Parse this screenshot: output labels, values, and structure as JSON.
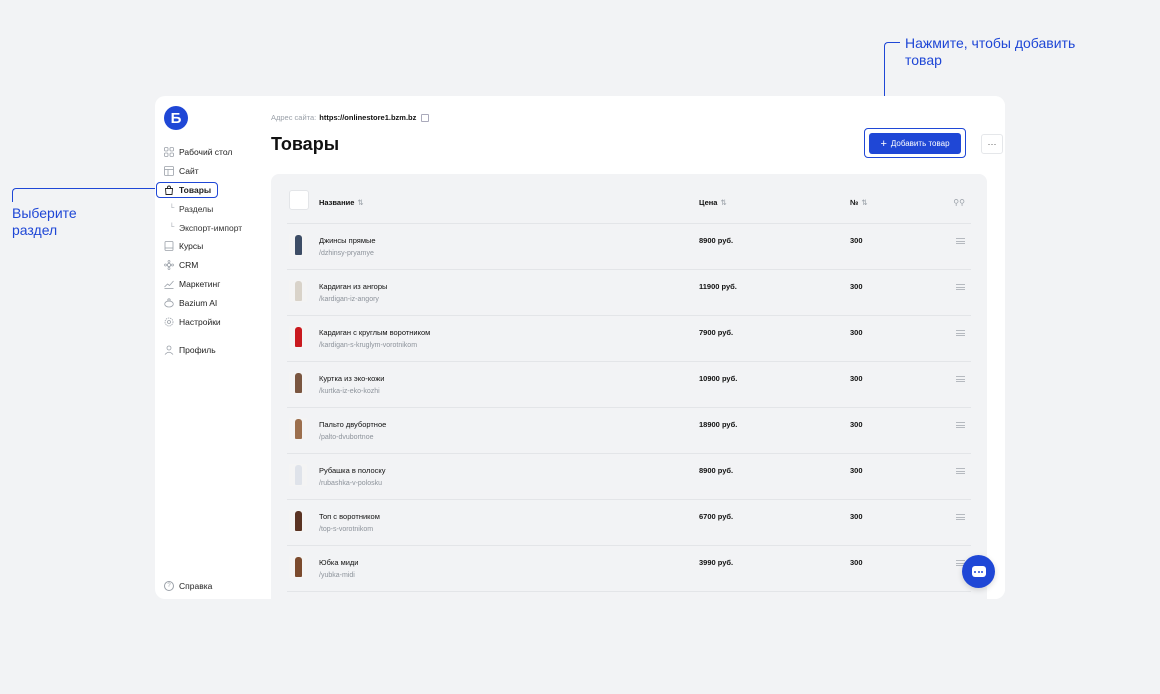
{
  "annotations": {
    "select_section": "Выберите раздел",
    "add_product_hint": "Нажмите, чтобы добавить товар"
  },
  "sidebar": {
    "logo": "Б",
    "items": [
      {
        "label": "Рабочий стол",
        "icon": "grid-icon"
      },
      {
        "label": "Сайт",
        "icon": "layout-icon"
      },
      {
        "label": "Товары",
        "icon": "bag-icon",
        "active": true
      },
      {
        "label": "Разделы",
        "icon": "sub-arrow-icon",
        "sub": true
      },
      {
        "label": "Экспорт-импорт",
        "icon": "sub-arrow-icon",
        "sub": true
      },
      {
        "label": "Курсы",
        "icon": "book-icon"
      },
      {
        "label": "CRM",
        "icon": "crm-icon"
      },
      {
        "label": "Маркетинг",
        "icon": "chart-icon"
      },
      {
        "label": "Bazium AI",
        "icon": "ai-icon"
      },
      {
        "label": "Настройки",
        "icon": "gear-icon"
      }
    ],
    "profile": "Профиль",
    "help": "Справка"
  },
  "header": {
    "site_label": "Адрес сайта:",
    "site_url": "https://onlinestore1.bzm.bz",
    "title": "Товары",
    "add_button": "Добавить товар",
    "more_button": "···"
  },
  "table": {
    "columns": {
      "name": "Название",
      "price": "Цена",
      "num": "№"
    },
    "rows": [
      {
        "name": "Джинсы прямые",
        "slug": "/dzhinsy-pryamye",
        "price": "8900 руб.",
        "num": "300",
        "color": "#3d4d66"
      },
      {
        "name": "Кардиган из ангоры",
        "slug": "/kardigan-iz-angory",
        "price": "11900 руб.",
        "num": "300",
        "color": "#d9d3c9"
      },
      {
        "name": "Кардиган с круглым воротником",
        "slug": "/kardigan-s-kruglym-vorotnikom",
        "price": "7900 руб.",
        "num": "300",
        "color": "#c9191e"
      },
      {
        "name": "Куртка из эко-кожи",
        "slug": "/kurtka-iz-eko-kozhi",
        "price": "10900 руб.",
        "num": "300",
        "color": "#7a5640"
      },
      {
        "name": "Пальто двубортное",
        "slug": "/palto-dvubortnoe",
        "price": "18900 руб.",
        "num": "300",
        "color": "#9c6f4d"
      },
      {
        "name": "Рубашка в полоску",
        "slug": "/rubashka-v-polosku",
        "price": "8900 руб.",
        "num": "300",
        "color": "#dfe3ea"
      },
      {
        "name": "Топ с воротником",
        "slug": "/top-s-vorotnikom",
        "price": "6700 руб.",
        "num": "300",
        "color": "#5a3322"
      },
      {
        "name": "Юбка миди",
        "slug": "/yubka-midi",
        "price": "3990 руб.",
        "num": "300",
        "color": "#7b4a2d"
      }
    ]
  }
}
